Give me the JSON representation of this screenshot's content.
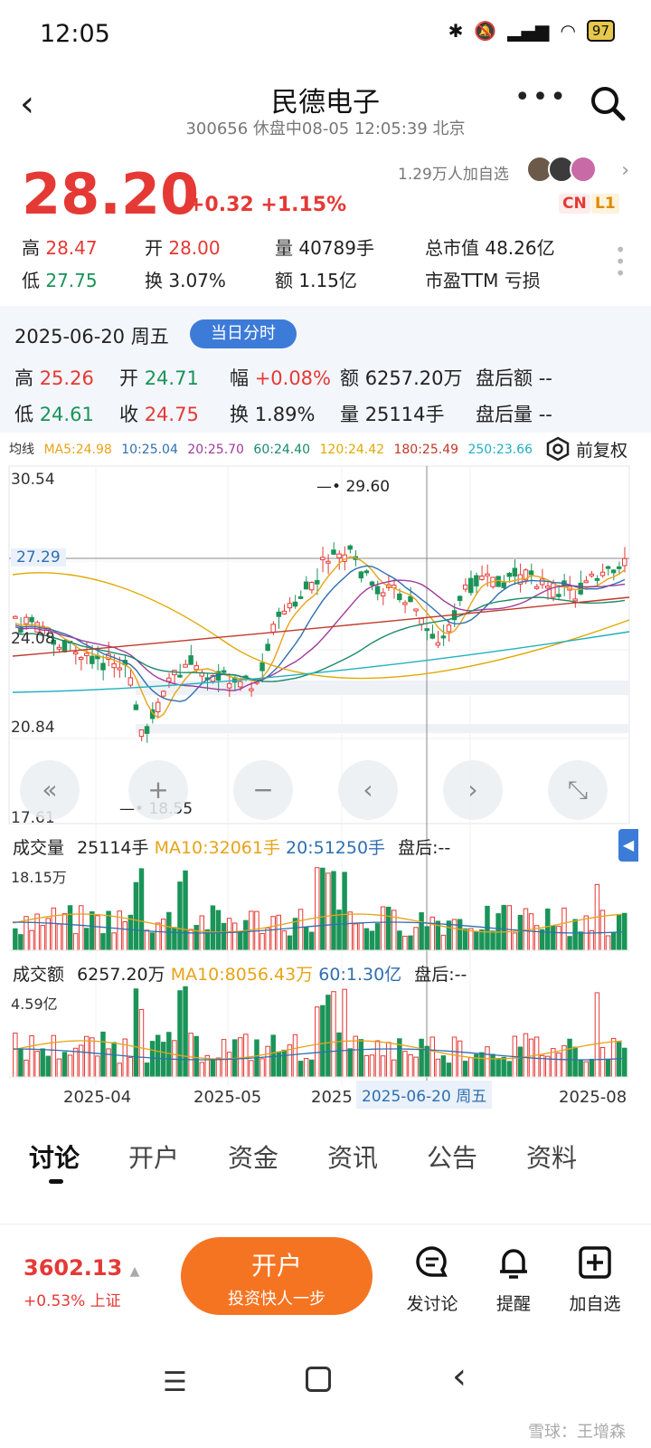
{
  "status_bar": {
    "time": "12:05",
    "battery": "97"
  },
  "header": {
    "title": "民德电子",
    "subtitle": "300656 休盘中08-05 12:05:39 北京"
  },
  "quote": {
    "price": "28.20",
    "change": "+0.32",
    "change_pct": "+1.15%",
    "followers": "1.29万人加自选",
    "tag_cn": "CN",
    "tag_l1": "L1",
    "high_label": "高",
    "high": "28.47",
    "low_label": "低",
    "low": "27.75",
    "open_label": "开",
    "open": "28.00",
    "turnover_label": "换",
    "turnover": "3.07%",
    "vol_label": "量",
    "vol": "40789手",
    "amt_label": "额",
    "amt": "1.15亿",
    "mcap_label": "总市值",
    "mcap": "48.26亿",
    "pe_label": "市盈TTM",
    "pe": "亏损"
  },
  "hist": {
    "date": "2025-06-20 周五",
    "button": "当日分时",
    "high": "25.26",
    "low": "24.61",
    "open": "24.71",
    "close": "24.75",
    "close_label": "收",
    "amp_label": "幅",
    "amp": "+0.08%",
    "turn": "1.89%",
    "amt": "6257.20万",
    "vol": "25114手",
    "after_amt_label": "盘后额",
    "after_amt": "--",
    "after_vol_label": "盘后量",
    "after_vol": "--"
  },
  "ma": {
    "label": "均线",
    "ma5": "MA5:24.98",
    "ma10": "10:25.04",
    "ma20": "20:25.70",
    "ma60": "60:24.40",
    "ma120": "120:24.42",
    "ma180": "180:25.49",
    "ma250": "250:23.66",
    "adjust": "前复权"
  },
  "chart_labels": {
    "y_top": "30.54",
    "y_cross": "27.29",
    "y_mid": "24.08",
    "y_low": "20.84",
    "y_bottom": "17.61",
    "max_mark": "29.60",
    "min_mark": "18.55"
  },
  "volume_panel": {
    "title": "成交量",
    "vol": "25114手",
    "ma10": "MA10:32061手",
    "ma20": "20:51250手",
    "after": "盘后:--",
    "ymax": "18.15万"
  },
  "amount_panel": {
    "title": "成交额",
    "amt": "6257.20万",
    "ma10": "MA10:8056.43万",
    "ma60": "60:1.30亿",
    "after": "盘后:--",
    "ymax": "4.59亿"
  },
  "x_axis": [
    "2025-04",
    "2025-05",
    "2025",
    "2025-08"
  ],
  "x_cursor": "2025-06-20 周五",
  "tabs": [
    "讨论",
    "开户",
    "资金",
    "资讯",
    "公告",
    "资料"
  ],
  "bottom": {
    "index_value": "3602.13",
    "index_sub": "+0.53% 上证",
    "open_title": "开户",
    "open_sub": "投资快人一步",
    "discuss": "发讨论",
    "remind": "提醒",
    "add": "加自选"
  },
  "watermark": "雪球：王增森",
  "colors": {
    "up": "#e53935",
    "down": "#1a9458",
    "accent": "#3d7bd9",
    "orange": "#f57422"
  }
}
